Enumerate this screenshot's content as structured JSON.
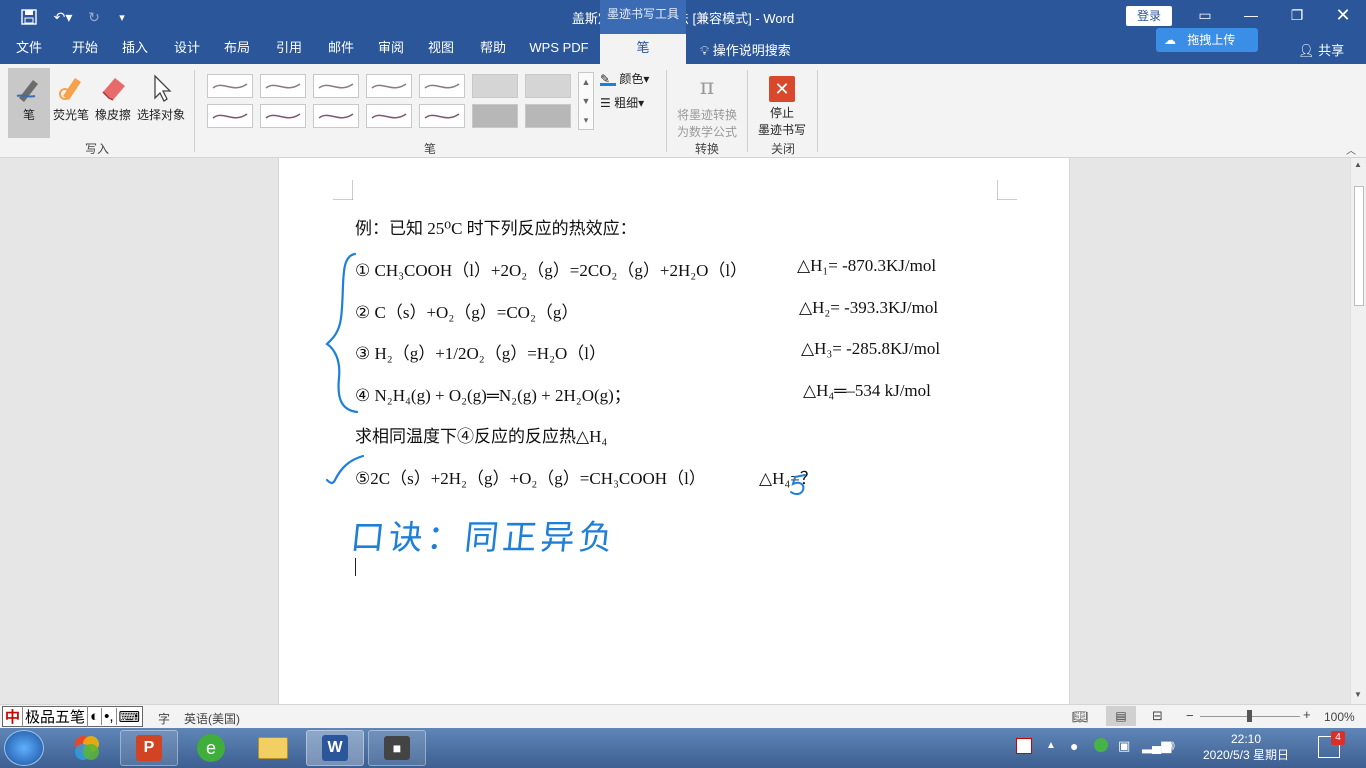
{
  "window": {
    "title": "盖斯定律计算新方法 [兼容模式] - Word",
    "contextual_tab_group": "墨迹书写工具",
    "login_label": "登录"
  },
  "tabs": [
    "文件",
    "开始",
    "插入",
    "设计",
    "布局",
    "引用",
    "邮件",
    "审阅",
    "视图",
    "帮助",
    "WPS PDF",
    "笔"
  ],
  "active_tab": "笔",
  "tell_me": "操作说明搜索",
  "upload_label": "拖拽上传",
  "share_label": "共享",
  "ribbon": {
    "write_group": {
      "label": "写入",
      "buttons": [
        "笔",
        "荧光笔",
        "橡皮擦",
        "选择对象"
      ]
    },
    "pens_group": {
      "label": "笔",
      "color_label": "颜色",
      "thickness_label": "粗细"
    },
    "convert_group": {
      "label": "转换",
      "button_line1": "将墨迹转换",
      "button_line2": "为数学公式"
    },
    "close_group": {
      "label": "关闭",
      "button_line1": "停止",
      "button_line2": "墨迹书写"
    }
  },
  "document": {
    "intro": "例：已知 25⁰C 时下列反应的热效应：",
    "reactions": [
      {
        "num": "①",
        "equation": "CH₃COOH（l）+2O₂（g）=2CO₂（g）+2H₂O（l）",
        "delta": "△H₁= -870.3KJ/mol"
      },
      {
        "num": "②",
        "equation": "C（s）+O₂（g）=CO₂（g）",
        "delta": "△H₂= -393.3KJ/mol"
      },
      {
        "num": "③",
        "equation": "H₂（g）+1/2O₂（g）=H₂O（l）",
        "delta": "△H₃= -285.8KJ/mol"
      },
      {
        "num": "④",
        "equation": "N₂H₄(g) + O₂(g)═N₂(g) + 2H₂O(g)；",
        "delta": "△H₄═–534 kJ/mol"
      }
    ],
    "question": "求相同温度下④反应的反应热△H₄",
    "target": "⑤2C（s）+2H₂（g）+O₂（g）=CH₃COOH（l）",
    "target_delta": "△H₄=？",
    "handwriting": "口诀：同正异负"
  },
  "statusbar": {
    "ime": [
      "中",
      "极品五笔",
      "◐",
      "•,",
      "⌨"
    ],
    "word_count_tail": "字",
    "language": "英语(美国)",
    "zoom": "100%"
  },
  "taskbar": {
    "time": "22:10",
    "date": "2020/5/3 星期日",
    "notification_count": "4"
  },
  "colors": {
    "word_blue": "#2b579a",
    "ink_blue": "#1e7fd8"
  }
}
